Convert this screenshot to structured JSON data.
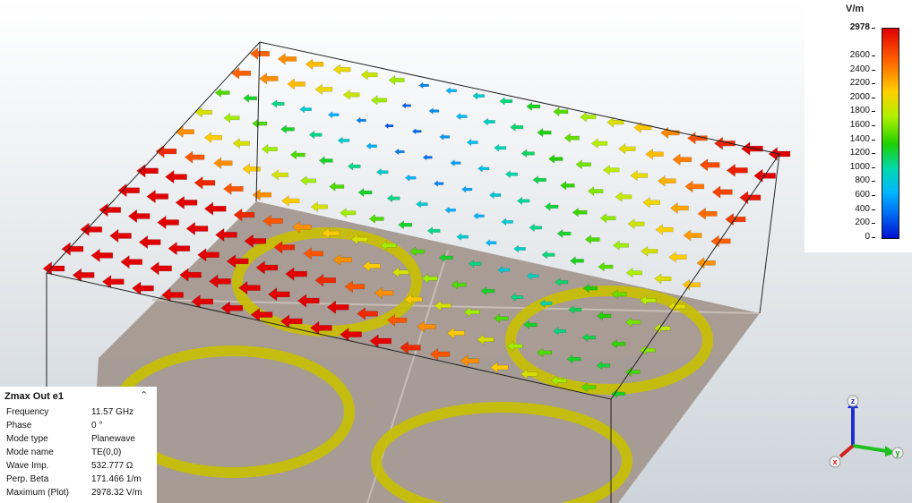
{
  "legend": {
    "unit": "V/m",
    "max_tick": "2978",
    "ticks": [
      "2600",
      "2400",
      "2200",
      "2000",
      "1800",
      "1600",
      "1400",
      "1200",
      "1000",
      "800",
      "600",
      "400",
      "200",
      "0"
    ]
  },
  "info": {
    "title": "Zmax Out e1",
    "rows": [
      {
        "label": "Frequency",
        "value": "11.57 GHz"
      },
      {
        "label": "Phase",
        "value": "0 °"
      },
      {
        "label": "Mode type",
        "value": "Planewave"
      },
      {
        "label": "Mode name",
        "value": "TE(0,0)"
      },
      {
        "label": "Wave Imp.",
        "value": "532.777 Ω"
      },
      {
        "label": "Perp. Beta",
        "value": "171.466 1/m"
      },
      {
        "label": "Maximum (Plot)",
        "value": "2978.32 V/m"
      }
    ]
  },
  "axes": {
    "x": "x",
    "y": "y",
    "z": "z"
  },
  "colors": {
    "background_top": "#ffffff",
    "background_bottom": "#cfd6dc",
    "substrate": "#a49890",
    "ring": "#c8c000"
  }
}
